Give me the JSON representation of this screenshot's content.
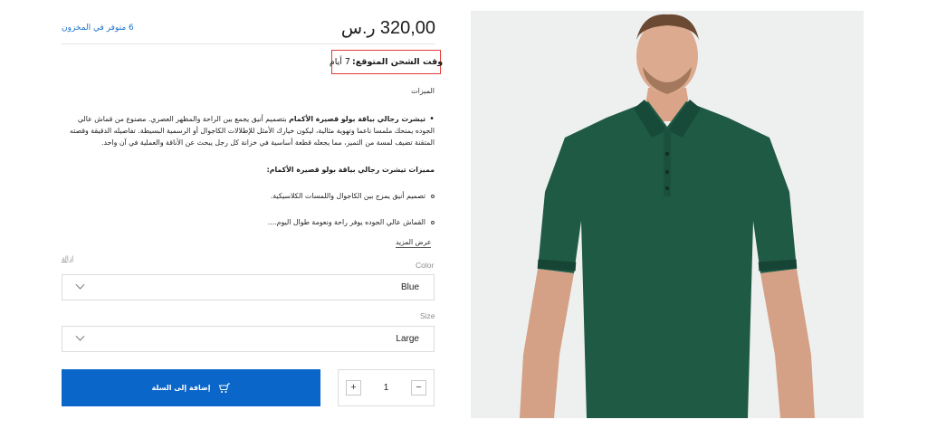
{
  "product": {
    "price_value": "320,00",
    "currency": "ر.س",
    "stock_text": "6 متوفر في المخزون",
    "shipping": {
      "label": "وقت الشحن المتوقع:",
      "value": "7 أيام"
    },
    "features_title": "الميزات",
    "description": {
      "bold_lead": "تيشرت رجالي بياقة بولو قصيرة الأكمام",
      "text": " بتصميم أنيق يجمع بين الراحة والمظهر العصري. مصنوع من قماش عالي الجوده يمنحك ملمسا ناعما وتهوية مثالية، ليكون خيارك الأمثل للإطلالات الكاجوال أو الرسمية البسيطة. تفاصيله الدقيقة وقصته المتقنة تضيف لمسة من التميز، مما يجعله قطعة أساسية في خزانة كل رجل يبحث عن الأناقة والعملية في آن واحد."
    },
    "sub_title": "مميزات تيشرت رجالي بياقة بولو قصيرة الأكمام:",
    "sub_items": [
      "تصميم أنيق يمزج بين الكاجوال واللمسات الكلاسيكية.",
      "القماش عالي الجوده يوفر راحة ونعومة طوال اليوم...."
    ],
    "show_more": "عرض المزيد",
    "remove_link": "إزالة",
    "color": {
      "label": "Color",
      "value": "Blue"
    },
    "size": {
      "label": "Size",
      "value": "Large"
    },
    "quantity": {
      "value": "1",
      "minus": "−",
      "plus": "+"
    },
    "add_to_cart_label": "إضافة إلى السلة"
  },
  "colors": {
    "accent": "#0a66c9",
    "stock": "#1d73c9",
    "highlight_border": "#e23b3b",
    "shirt": "#1f5a45"
  },
  "icons": {
    "cart": "cart-icon",
    "chevron": "chevron-down-icon"
  }
}
